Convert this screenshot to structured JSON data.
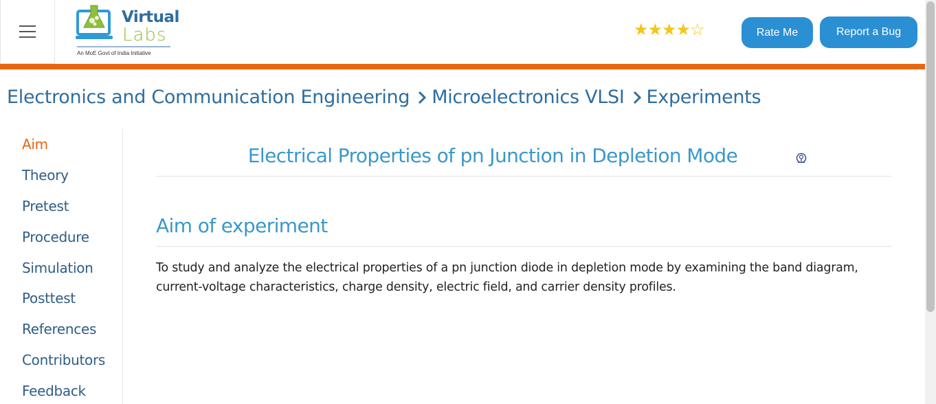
{
  "header": {
    "logo_brand_top": "Virtual",
    "logo_brand_bottom": "Labs",
    "logo_tagline": "An MoE Govt of India Initiative",
    "rating": {
      "filled": 4,
      "total": 5
    },
    "rate_button": "Rate Me",
    "bug_button": "Report a Bug",
    "accent_color": "#e8660f",
    "button_color": "#2b8fd4"
  },
  "breadcrumb": {
    "items": [
      "Electronics and Communication Engineering",
      "Microelectronics VLSI",
      "Experiments"
    ]
  },
  "sidebar": {
    "items": [
      {
        "label": "Aim",
        "active": true
      },
      {
        "label": "Theory"
      },
      {
        "label": "Pretest"
      },
      {
        "label": "Procedure"
      },
      {
        "label": "Simulation"
      },
      {
        "label": "Posttest"
      },
      {
        "label": "References"
      },
      {
        "label": "Contributors"
      },
      {
        "label": "Feedback"
      }
    ]
  },
  "main": {
    "experiment_title": "Electrical Properties of pn Junction in Depletion Mode",
    "title_icon": "institute-emblem-icon",
    "section_heading": "Aim of experiment",
    "aim_text": "To study and analyze the electrical properties of a pn junction diode in depletion mode by examining the band diagram, current-voltage characteristics, charge density, electric field, and carrier density profiles."
  }
}
